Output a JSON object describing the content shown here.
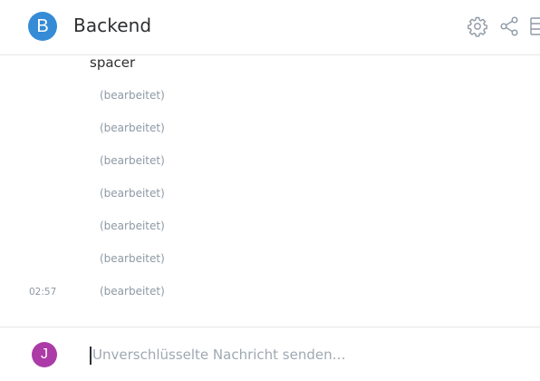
{
  "header": {
    "avatar_letter": "B",
    "room_name": "Backend",
    "avatar_color": "#368bd6",
    "icons": [
      "settings-icon",
      "share-icon",
      "right-panel-icon"
    ]
  },
  "timeline": {
    "message_text": "spacer",
    "edited_label": "(bearbeitet)",
    "edited_rows": [
      {
        "label": "(bearbeitet)",
        "time": ""
      },
      {
        "label": "(bearbeitet)",
        "time": ""
      },
      {
        "label": "(bearbeitet)",
        "time": ""
      },
      {
        "label": "(bearbeitet)",
        "time": ""
      },
      {
        "label": "(bearbeitet)",
        "time": ""
      },
      {
        "label": "(bearbeitet)",
        "time": ""
      },
      {
        "label": "(bearbeitet)",
        "time": "02:57"
      }
    ]
  },
  "composer": {
    "avatar_letter": "J",
    "avatar_color": "#ac3ba8",
    "placeholder": "Unverschlüsselte Nachricht senden…",
    "value": ""
  }
}
